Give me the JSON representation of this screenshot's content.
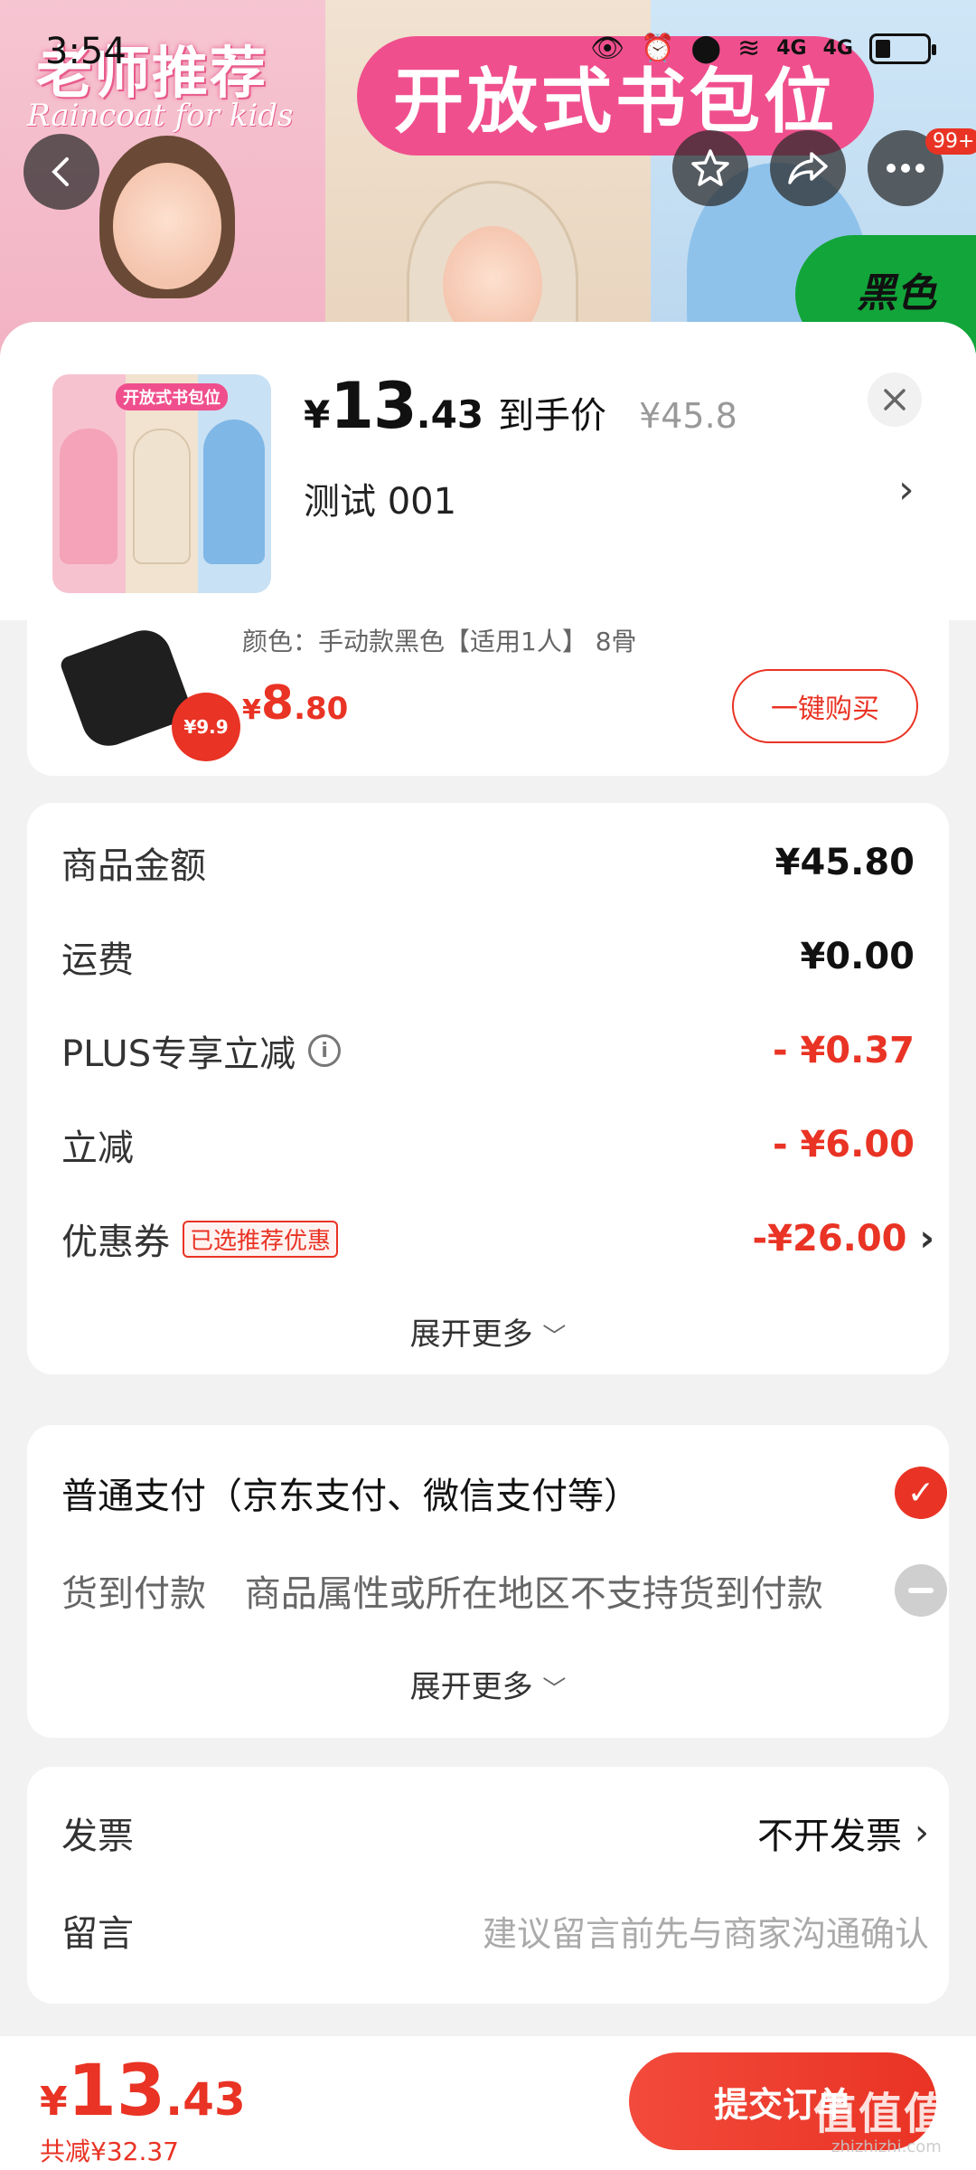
{
  "status_bar": {
    "time": "3:54",
    "network": "4G"
  },
  "banner": {
    "text_left": "老师推荐",
    "text_left_sub": "Raincoat for kids",
    "text_center": "开放式书包位",
    "tag": "黑色"
  },
  "nav": {
    "badge": "99+"
  },
  "product": {
    "currency": "¥",
    "price_int": "13",
    "price_dec": ".43",
    "price_label": "到手价",
    "original_price": "¥45.8",
    "spec": "测试  001",
    "thumb_label": "开放式书包位"
  },
  "upsell": {
    "color_desc": "颜色：手动款黑色【适用1人】 8骨",
    "sale_tag": "¥9.9",
    "price_currency": "¥",
    "price_int": "8",
    "price_dec": ".80",
    "buy_label": "一键购买"
  },
  "cost": {
    "goods_label": "商品金额",
    "goods_value": "¥45.80",
    "shipping_label": "运费",
    "shipping_value": "¥0.00",
    "plus_label": "PLUS专享立减",
    "plus_value": "- ¥0.37",
    "discount_label": "立减",
    "discount_value": "- ¥6.00",
    "coupon_label": "优惠券",
    "coupon_tag": "已选推荐优惠",
    "coupon_value": "-¥26.00",
    "expand_label": "展开更多"
  },
  "payment": {
    "normal_label": "普通支付（京东支付、微信支付等）",
    "cod_label": "货到付款",
    "cod_note": "商品属性或所在地区不支持货到付款",
    "expand_label": "展开更多"
  },
  "invoice": {
    "invoice_label": "发票",
    "invoice_value": "不开发票",
    "note_label": "留言",
    "note_placeholder": "建议留言前先与商家沟通确认"
  },
  "bottom": {
    "currency": "¥",
    "total_int": "13",
    "total_dec": ".43",
    "saved": "共减¥32.37",
    "submit_label": "提交订单"
  },
  "watermark": {
    "main": "值值值",
    "sub": "zhizhizhi.com"
  },
  "colors": {
    "accent": "#e93324",
    "banner_pink": "#f04f8d",
    "tag_green": "#12a53a"
  }
}
